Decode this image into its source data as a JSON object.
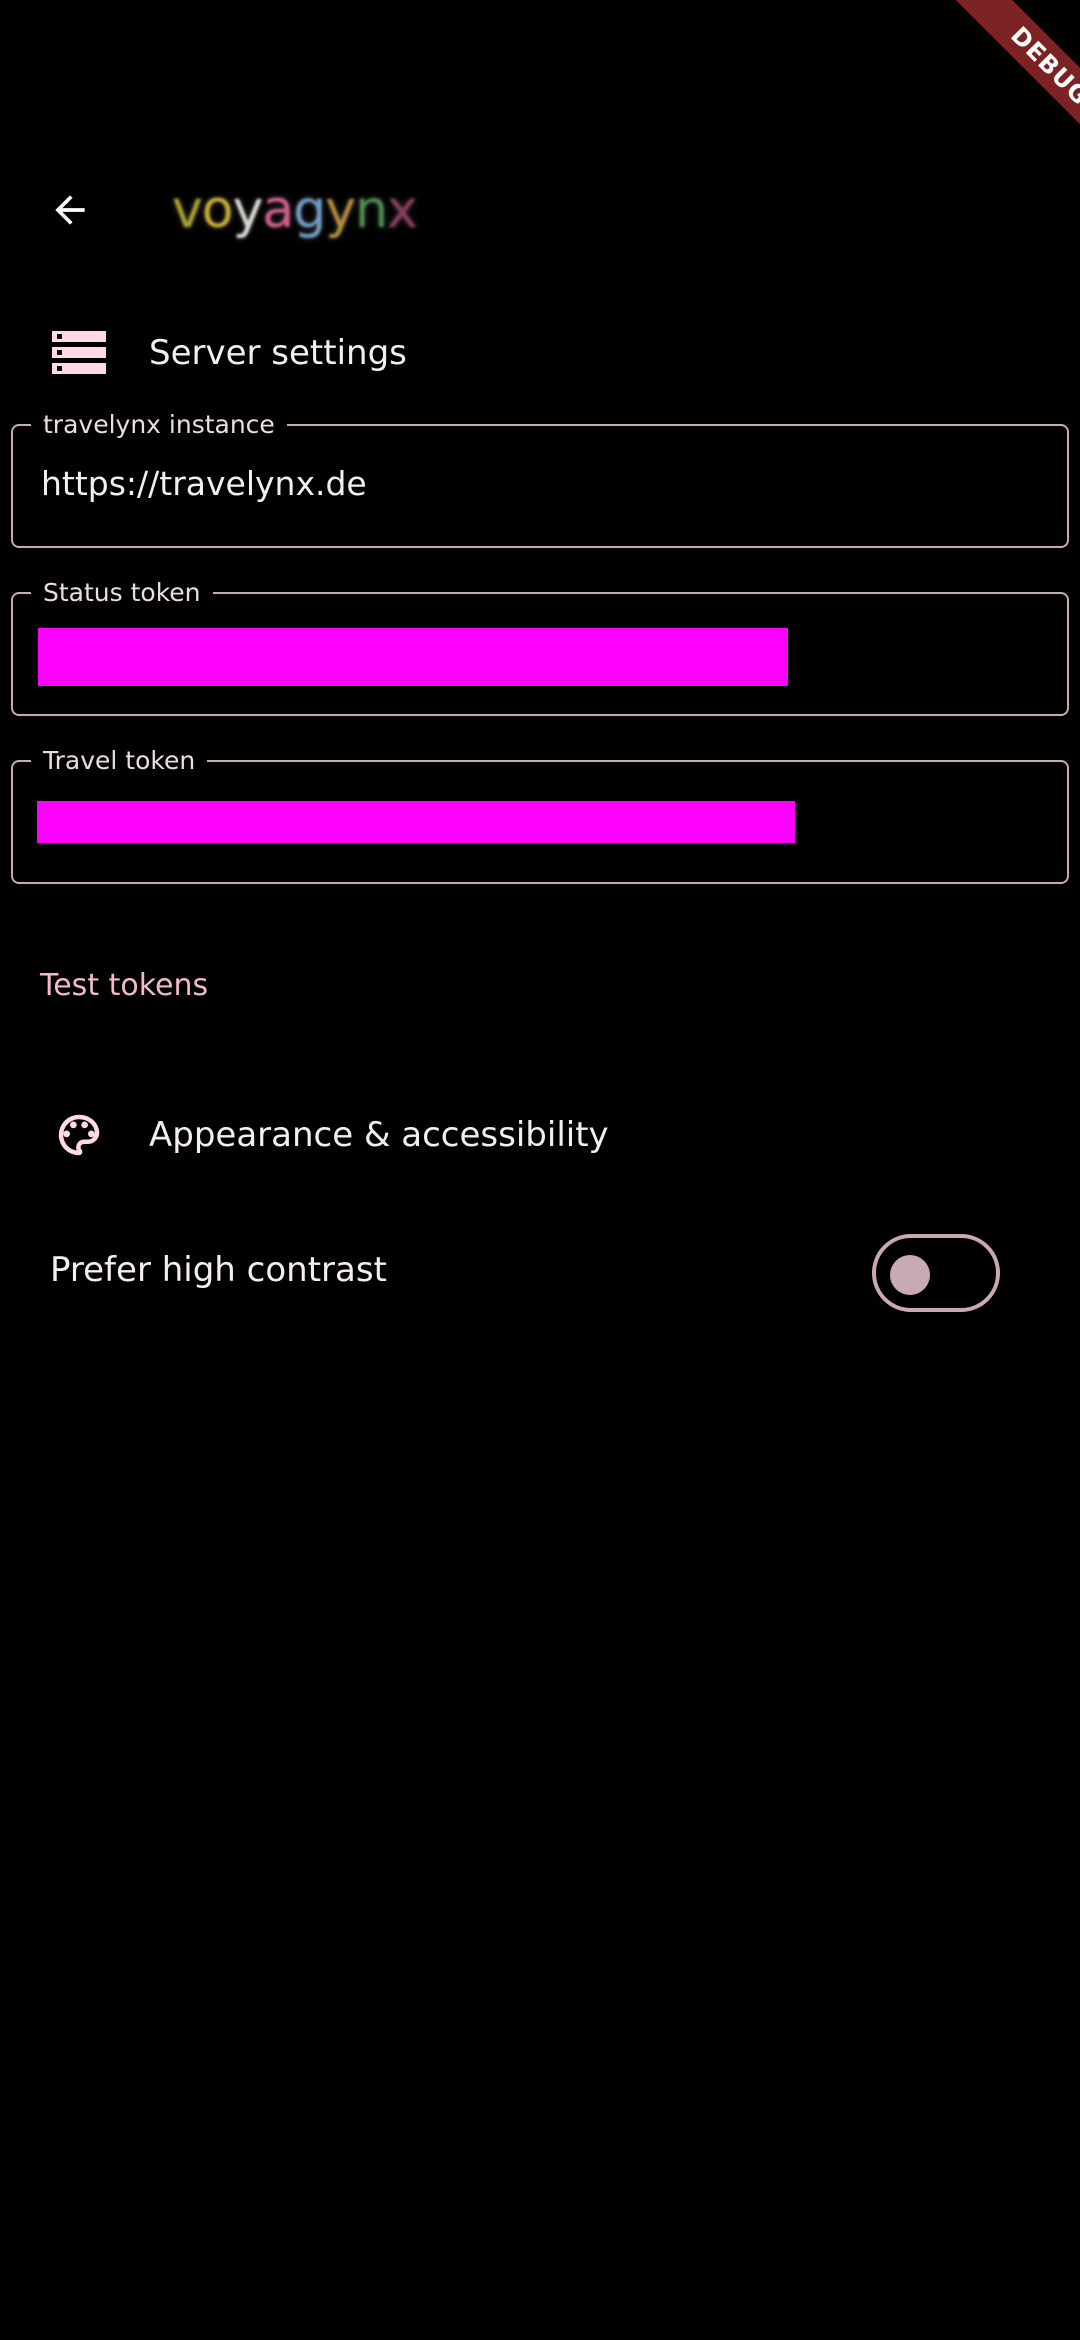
{
  "debug_banner": "DEBUG",
  "app_bar": {
    "logo_letters": [
      {
        "ch": "v",
        "color": "#a8a02a"
      },
      {
        "ch": "o",
        "color": "#c8aa30"
      },
      {
        "ch": "y",
        "color": "#d9d7d2"
      },
      {
        "ch": "a",
        "color": "#d35d8f"
      },
      {
        "ch": "g",
        "color": "#6f9bc6"
      },
      {
        "ch": "y",
        "color": "#b48a3a"
      },
      {
        "ch": "n",
        "color": "#4e8a50"
      },
      {
        "ch": "x",
        "color": "#8a3a5c"
      }
    ]
  },
  "server_section": {
    "title": "Server settings",
    "icon": "server-icon"
  },
  "fields": {
    "instance": {
      "label": "travelynx instance",
      "value": "https://travelynx.de"
    },
    "status_token": {
      "label": "Status token",
      "value": ""
    },
    "travel_token": {
      "label": "Travel token",
      "value": ""
    }
  },
  "test_tokens_label": "Test tokens",
  "appearance_section": {
    "title": "Appearance & accessibility",
    "icon": "palette-icon"
  },
  "high_contrast": {
    "label": "Prefer high contrast",
    "enabled": false
  },
  "colors": {
    "background": "#000000",
    "outline": "#c9a9b3",
    "accent": "#f2b8cf",
    "icon": "#ffd9e3",
    "redaction": "#ff00ff",
    "debug": "#7a2322"
  }
}
